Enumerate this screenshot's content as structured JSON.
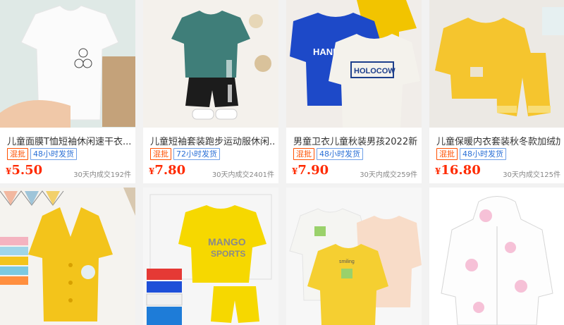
{
  "products": [
    {
      "title": "儿童面膜T恤短袖休闲速干衣...",
      "tag_mix": "混批",
      "tag_ship": "48小时发货",
      "currency": "¥",
      "price": "5.50",
      "sales": "30天内成交192件",
      "image": "white-tshirt",
      "colors": {
        "bg": "#dfe9e6",
        "shirt": "#fbfbfb"
      }
    },
    {
      "title": "儿童短袖套装跑步运动服休闲...",
      "tag_mix": "混批",
      "tag_ship": "72小时发货",
      "currency": "¥",
      "price": "7.80",
      "sales": "30天内成交2401件",
      "image": "teal-sport-set",
      "colors": {
        "bg": "#f4f1ec",
        "shirt": "#3f7e79",
        "shorts": "#1c1c1c"
      }
    },
    {
      "title": "男童卫衣儿童秋装男孩2022新...",
      "tag_mix": "混批",
      "tag_ship": "48小时发货",
      "currency": "¥",
      "price": "7.90",
      "sales": "30天内成交259件",
      "image": "hoodies",
      "colors": {
        "bg": "#f1ede9",
        "blue": "#1d49c8",
        "white": "#f4f2ec",
        "yellow": "#f2c400"
      }
    },
    {
      "title": "儿童保暖内衣套装秋冬款加绒加...",
      "tag_mix": "混批",
      "tag_ship": "48小时发货",
      "currency": "¥",
      "price": "16.80",
      "sales": "30天内成交125件",
      "image": "yellow-thermal-set",
      "colors": {
        "bg": "#ece9e4",
        "yellow": "#f5c52e"
      }
    }
  ],
  "row2": [
    {
      "image": "yellow-cardigan",
      "colors": {
        "bg": "#f5f3ef",
        "yellow": "#f3c41b"
      }
    },
    {
      "image": "mango-sports-set",
      "colors": {
        "bg": "#f6f6f6",
        "yellow": "#f6d800",
        "text": "MANGO",
        "sub": "SPORTS"
      }
    },
    {
      "image": "smiley-sweaters",
      "colors": {
        "bg": "#f7f7f7",
        "yellow": "#f5cf31",
        "peach": "#f8dcc8",
        "white": "#f5f5f2"
      },
      "label": "smiling"
    },
    {
      "image": "hooded-jacket",
      "colors": {
        "bg": "#ffffff",
        "print": "#f2a7c6"
      }
    }
  ]
}
